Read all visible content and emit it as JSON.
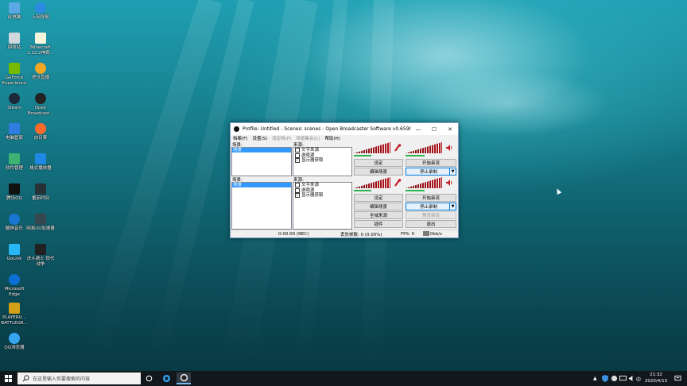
{
  "desktop": {
    "icons": [
      {
        "label": "此电脑",
        "icon": "computer-icon",
        "color": "#5aa9e6"
      },
      {
        "label": "上网导航",
        "icon": "browser-nav-icon",
        "color": "#2b8be0"
      },
      {
        "label": "回收站",
        "icon": "recycle-bin-icon",
        "color": "#cfd8dc"
      },
      {
        "label": "Minecraft 1.12.2神奇...",
        "icon": "file-icon",
        "color": "#f5f5dc"
      },
      {
        "label": "GeForce Experience",
        "icon": "geforce-icon",
        "color": "#76b900"
      },
      {
        "label": "虎牙直播",
        "icon": "huya-icon",
        "color": "#f5a623"
      },
      {
        "label": "Steam",
        "icon": "steam-icon",
        "color": "#1b2838"
      },
      {
        "label": "Open Broadcast...",
        "icon": "obs-icon",
        "color": "#222222"
      },
      {
        "label": "电脑管家",
        "icon": "pc-manager-icon",
        "color": "#2f7de1"
      },
      {
        "label": "向日葵",
        "icon": "sunflower-icon",
        "color": "#ff6a2b"
      },
      {
        "label": "软件管理",
        "icon": "software-manager-icon",
        "color": "#3cb371"
      },
      {
        "label": "格式播放器",
        "icon": "player-icon",
        "color": "#1e88e5"
      },
      {
        "label": "腾讯QQ",
        "icon": "qq-icon",
        "color": "#111111"
      },
      {
        "label": "番茄时间",
        "icon": "tomato-icon",
        "color": "#263238"
      },
      {
        "label": "酷狗音乐",
        "icon": "kugou-icon",
        "color": "#1976d2"
      },
      {
        "label": "网易UU加速器",
        "icon": "uu-icon",
        "color": "#37474f"
      },
      {
        "label": "GoLink",
        "icon": "golink-icon",
        "color": "#29b6f6"
      },
      {
        "label": "决斗骑士 现代战争",
        "icon": "game-icon",
        "color": "#212121"
      },
      {
        "label": "Microsoft Edge",
        "icon": "edge-icon",
        "color": "#0c6fd6"
      },
      {
        "label": "PLAYERU... BATTLEGR...",
        "icon": "pubg-icon",
        "color": "#d4a017"
      },
      {
        "label": "QQ浏览器",
        "icon": "qq-browser-icon",
        "color": "#36a6f2"
      }
    ]
  },
  "obs": {
    "title": "Profile: Untitled - Scenes: scenes - Open Broadcaster Software v0.659b",
    "menu": [
      {
        "label": "档案(F)",
        "disabled": false
      },
      {
        "label": "设置(S)",
        "disabled": false
      },
      {
        "label": "设定档(P)",
        "disabled": true
      },
      {
        "label": "场景集合(C)",
        "disabled": true
      },
      {
        "label": "帮助(H)",
        "disabled": false
      }
    ],
    "panels": [
      {
        "scenes_label": "场景:",
        "selected_scene": "场景",
        "sources_label": "来源:",
        "sources": [
          {
            "label": "文字来源",
            "checked": false
          },
          {
            "label": "游戏源",
            "checked": false
          },
          {
            "label": "显示器获取",
            "checked": true
          }
        ],
        "buttons": {
          "settings": "设定",
          "start_stream": "开始串流",
          "edit_scene": "编辑场景",
          "stop_record": "停止录制"
        }
      },
      {
        "scenes_label": "场景:",
        "selected_scene": "场景",
        "sources_label": "来源:",
        "sources": [
          {
            "label": "文字来源",
            "checked": false
          },
          {
            "label": "游戏源",
            "checked": false
          },
          {
            "label": "显示器获取",
            "checked": true
          }
        ],
        "buttons": {
          "settings": "设定",
          "start_stream": "开始串流",
          "edit_scene": "编辑场景",
          "stop_record": "停止录制",
          "fullscreen_preview": "全域来源",
          "plugins": "插件",
          "exit": "退出",
          "preview_stream": "预览串流"
        }
      }
    ],
    "status": {
      "time": "0:00:00 (REC)",
      "dropped": "丢失帧数: 0 (0.00%)",
      "fps": "FPS: 0",
      "kbps": "0kb/s"
    },
    "accent": "#b3161d"
  },
  "taskbar": {
    "search_placeholder": "在这里输入你要搜索的内容",
    "clock_time": "21:32",
    "clock_date": "2020/4/13",
    "tray_lang": "中"
  }
}
